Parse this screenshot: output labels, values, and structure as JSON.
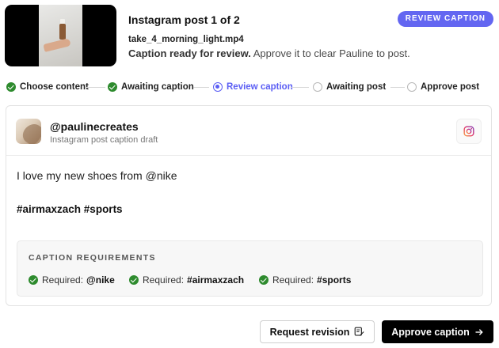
{
  "header": {
    "title": "Instagram post 1 of 2",
    "filename": "take_4_morning_light.mp4",
    "status_strong": "Caption ready for review.",
    "status_rest": " Approve it to clear Pauline to post.",
    "badge": "REVIEW CAPTION"
  },
  "stepper": {
    "steps": [
      {
        "label": "Choose content",
        "state": "done"
      },
      {
        "label": "Awaiting caption",
        "state": "done"
      },
      {
        "label": "Review caption",
        "state": "current"
      },
      {
        "label": "Awaiting post",
        "state": "todo"
      },
      {
        "label": "Approve post",
        "state": "todo"
      }
    ]
  },
  "card": {
    "handle": "@paulinecreates",
    "subtitle": "Instagram post caption draft",
    "platform_icon": "instagram-icon",
    "caption": "I love my new shoes from @nike",
    "hashtags": "#airmaxzach #sports",
    "requirements": {
      "title": "CAPTION REQUIREMENTS",
      "items": [
        {
          "prefix": "Required:",
          "value": "@nike"
        },
        {
          "prefix": "Required:",
          "value": "#airmaxzach"
        },
        {
          "prefix": "Required:",
          "value": "#sports"
        }
      ]
    }
  },
  "actions": {
    "request_revision": "Request revision",
    "approve": "Approve caption"
  },
  "colors": {
    "accent": "#6366f1",
    "success": "#2e8b2e",
    "primary_button": "#000000"
  }
}
